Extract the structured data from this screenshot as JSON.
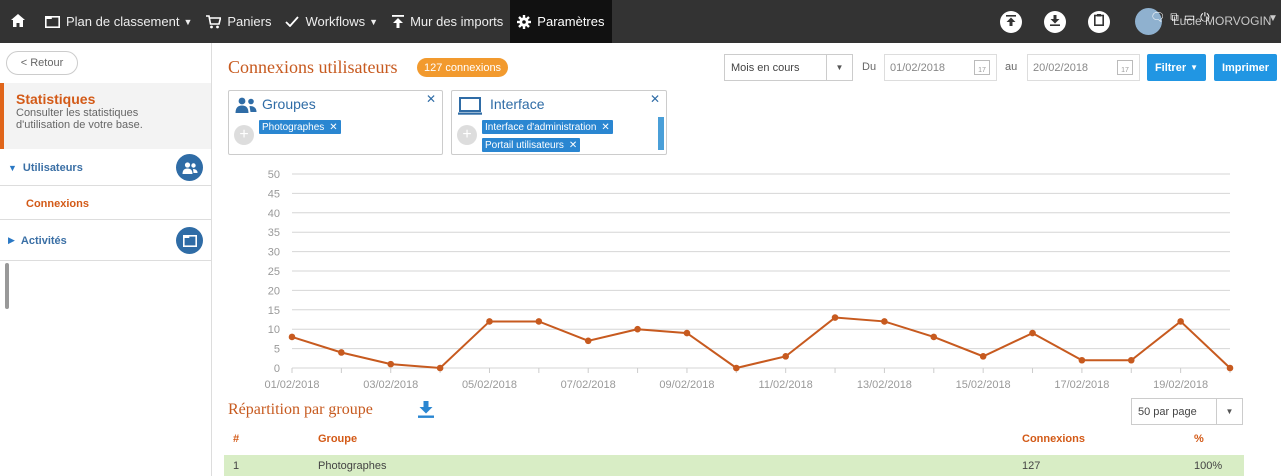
{
  "topbar": {
    "nav": [
      {
        "label": "Plan de classement",
        "icon": "folder-icon",
        "caret": true
      },
      {
        "label": "Paniers",
        "icon": "cart-icon",
        "caret": false
      },
      {
        "label": "Workflows",
        "icon": "check-icon",
        "caret": true
      },
      {
        "label": "Mur des imports",
        "icon": "upload-icon",
        "caret": false
      },
      {
        "label": "Paramètres",
        "icon": "gear-icon",
        "caret": false,
        "active": true
      }
    ],
    "user_name": "Lucie MORVOGIN"
  },
  "sidebar": {
    "back_label": "< Retour",
    "title": "Statistiques",
    "description": "Consulter les statistiques d'utilisation de votre base.",
    "sections": [
      {
        "label": "Utilisateurs",
        "expanded": true,
        "icon": "users-icon"
      },
      {
        "label": "Activités",
        "expanded": false,
        "icon": "folder-icon"
      }
    ],
    "sub_item": "Connexions"
  },
  "header": {
    "title": "Connexions utilisateurs",
    "badge": "127 connexions",
    "period": "Mois en cours",
    "from_label": "Du",
    "from_date": "01/02/2018",
    "to_label": "au",
    "to_date": "20/02/2018",
    "calendar_day": "17",
    "filter_label": "Filtrer",
    "print_label": "Imprimer"
  },
  "filters": {
    "groups": {
      "title": "Groupes",
      "tags": [
        "Photographes"
      ]
    },
    "interface": {
      "title": "Interface",
      "tags": [
        "Interface d'administration",
        "Portail utilisateurs"
      ]
    }
  },
  "chart_data": {
    "type": "line",
    "x": [
      "01/02/2018",
      "02/02/2018",
      "03/02/2018",
      "04/02/2018",
      "05/02/2018",
      "06/02/2018",
      "07/02/2018",
      "08/02/2018",
      "09/02/2018",
      "10/02/2018",
      "11/02/2018",
      "12/02/2018",
      "13/02/2018",
      "14/02/2018",
      "15/02/2018",
      "16/02/2018",
      "17/02/2018",
      "18/02/2018",
      "19/02/2018",
      "20/02/2018"
    ],
    "x_tick_labels": [
      "01/02/2018",
      "03/02/2018",
      "05/02/2018",
      "07/02/2018",
      "09/02/2018",
      "11/02/2018",
      "13/02/2018",
      "15/02/2018",
      "17/02/2018",
      "19/02/2018"
    ],
    "values": [
      8,
      4,
      1,
      0,
      12,
      12,
      7,
      10,
      9,
      0,
      3,
      13,
      12,
      8,
      3,
      9,
      2,
      2,
      12,
      0
    ],
    "ylim": [
      0,
      50
    ],
    "yticks": [
      0,
      5,
      10,
      15,
      20,
      25,
      30,
      35,
      40,
      45,
      50
    ],
    "grid": true,
    "color": "#c75a1f"
  },
  "table": {
    "title": "Répartition par groupe",
    "page_size": "50 par page",
    "columns": [
      "#",
      "Groupe",
      "Connexions",
      "%"
    ],
    "rows": [
      [
        "1",
        "Photographes",
        "127",
        "100%"
      ]
    ]
  }
}
